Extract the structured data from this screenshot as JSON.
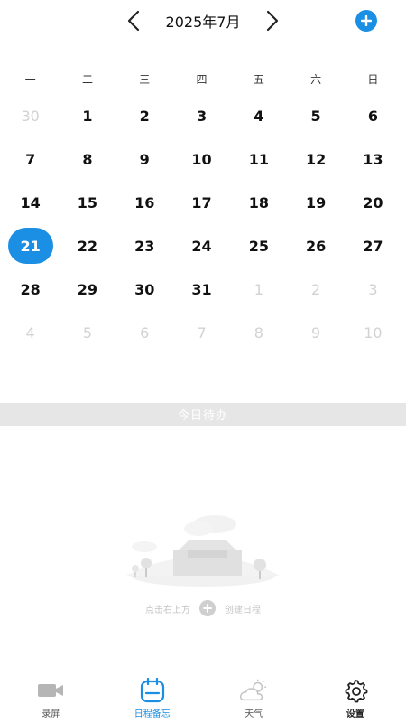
{
  "header": {
    "month_title": "2025年7月",
    "accent_color": "#1a8fe3"
  },
  "weekdays": [
    "一",
    "二",
    "三",
    "四",
    "五",
    "六",
    "日"
  ],
  "calendar": {
    "selected_day": "21",
    "days": [
      {
        "d": "30",
        "m": true
      },
      {
        "d": "1",
        "m": false
      },
      {
        "d": "2",
        "m": false
      },
      {
        "d": "3",
        "m": false
      },
      {
        "d": "4",
        "m": false
      },
      {
        "d": "5",
        "m": false
      },
      {
        "d": "6",
        "m": false
      },
      {
        "d": "7",
        "m": false
      },
      {
        "d": "8",
        "m": false
      },
      {
        "d": "9",
        "m": false
      },
      {
        "d": "10",
        "m": false
      },
      {
        "d": "11",
        "m": false
      },
      {
        "d": "12",
        "m": false
      },
      {
        "d": "13",
        "m": false
      },
      {
        "d": "14",
        "m": false
      },
      {
        "d": "15",
        "m": false
      },
      {
        "d": "16",
        "m": false
      },
      {
        "d": "17",
        "m": false
      },
      {
        "d": "18",
        "m": false
      },
      {
        "d": "19",
        "m": false
      },
      {
        "d": "20",
        "m": false
      },
      {
        "d": "21",
        "m": false
      },
      {
        "d": "22",
        "m": false
      },
      {
        "d": "23",
        "m": false
      },
      {
        "d": "24",
        "m": false
      },
      {
        "d": "25",
        "m": false
      },
      {
        "d": "26",
        "m": false
      },
      {
        "d": "27",
        "m": false
      },
      {
        "d": "28",
        "m": false
      },
      {
        "d": "29",
        "m": false
      },
      {
        "d": "30",
        "m": false
      },
      {
        "d": "31",
        "m": false
      },
      {
        "d": "1",
        "m": true
      },
      {
        "d": "2",
        "m": true
      },
      {
        "d": "3",
        "m": true
      },
      {
        "d": "4",
        "m": true
      },
      {
        "d": "5",
        "m": true
      },
      {
        "d": "6",
        "m": true
      },
      {
        "d": "7",
        "m": true
      },
      {
        "d": "8",
        "m": true
      },
      {
        "d": "9",
        "m": true
      },
      {
        "d": "10",
        "m": true
      }
    ]
  },
  "todo": {
    "section_title": "今日待办",
    "hint_left": "点击右上方",
    "hint_right": "创建日程"
  },
  "tabbar": {
    "items": [
      {
        "label": "录屏",
        "icon": "video-camera-icon"
      },
      {
        "label": "日程备忘",
        "icon": "calendar-icon"
      },
      {
        "label": "天气",
        "icon": "weather-cloud-sun-icon"
      },
      {
        "label": "设置",
        "icon": "gear-icon"
      }
    ]
  }
}
